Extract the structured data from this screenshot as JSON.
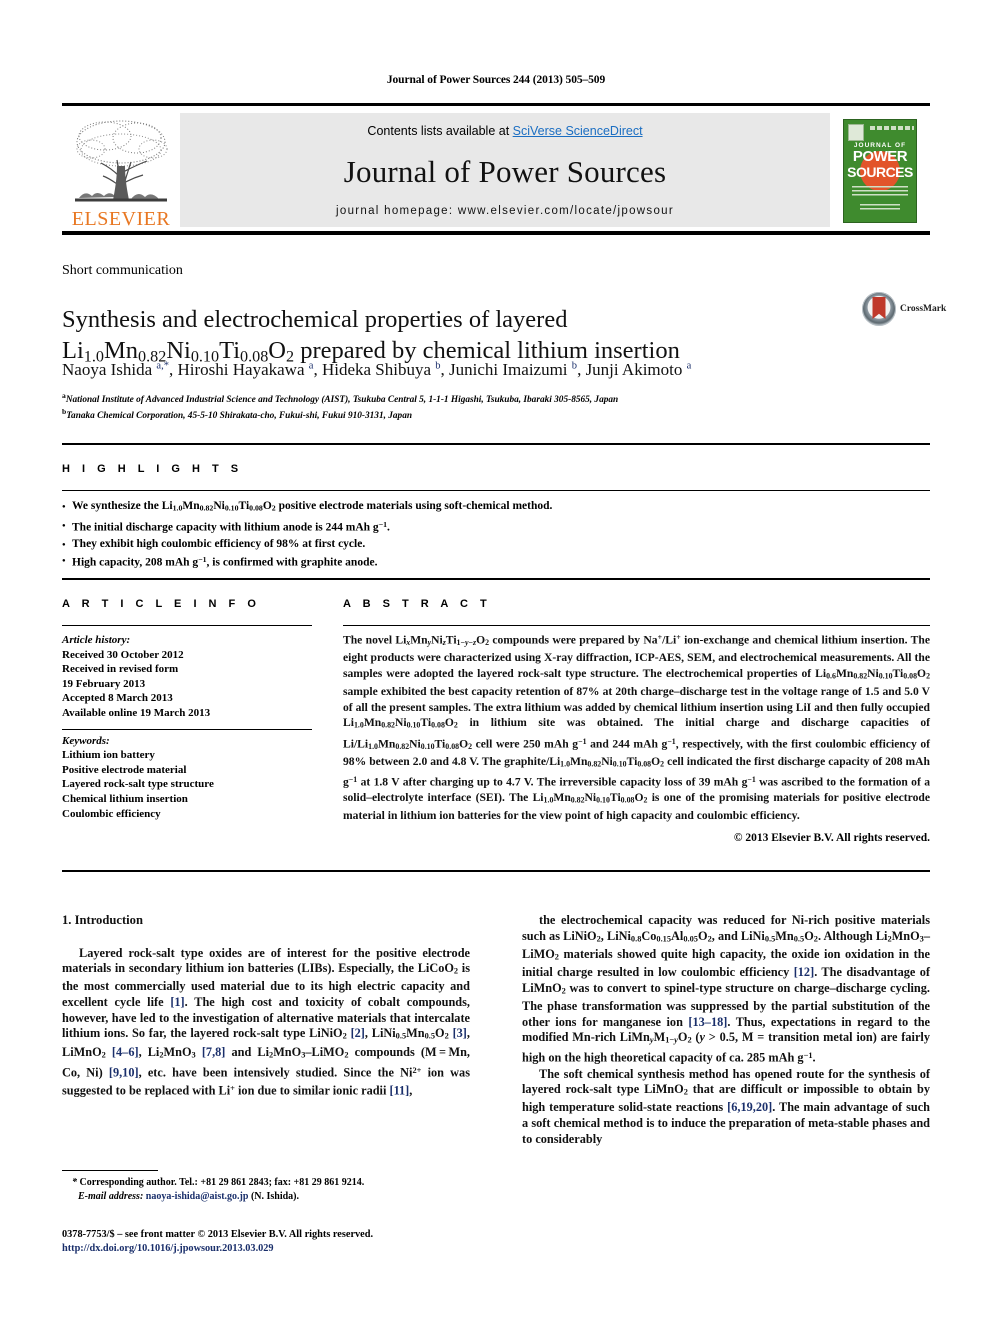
{
  "running_head": "Journal of Power Sources 244 (2013) 505–509",
  "masthead": {
    "publisher_name": "ELSEVIER",
    "contents_prefix": "Contents lists available at ",
    "contents_link": "SciVerse ScienceDirect",
    "journal_title": "Journal of Power Sources",
    "homepage_label": "journal homepage: www.elsevier.com/locate/jpowsour",
    "cover": {
      "line1": "JOURNAL OF",
      "line2": "POWER",
      "line3": "SOURCES"
    }
  },
  "article": {
    "type": "Short communication",
    "title_line1": "Synthesis and electrochemical properties of layered",
    "title_line2_html": "Li<sub>1.0</sub>Mn<sub>0.82</sub>Ni<sub>0.10</sub>Ti<sub>0.08</sub>O<sub>2</sub> prepared by chemical lithium insertion",
    "crossmark_label": "CrossMark",
    "authors_html": "Naoya Ishida <sup>a,*</sup>, Hiroshi Hayakawa <sup>a</sup>, Hideka Shibuya <sup>b</sup>, Junichi Imaizumi <sup>b</sup>, Junji Akimoto <sup>a</sup>",
    "affiliations": [
      "National Institute of Advanced Industrial Science and Technology (AIST), Tsukuba Central 5, 1-1-1 Higashi, Tsukuba, Ibaraki 305-8565, Japan",
      "Tanaka Chemical Corporation, 45-5-10 Shirakata-cho, Fukui-shi, Fukui 910-3131, Japan"
    ],
    "affiliation_marks": [
      "a",
      "b"
    ]
  },
  "highlights": {
    "heading": "H I G H L I G H T S",
    "items_html": [
      "We synthesize the Li<sub class=\"s\">1.0</sub>Mn<sub class=\"s\">0.82</sub>Ni<sub class=\"s\">0.10</sub>Ti<sub class=\"s\">0.08</sub>O<sub class=\"s\">2</sub> positive electrode materials using soft-chemical method.",
      "The initial discharge capacity with lithium anode is 244 mAh g<sup class=\"s\">−1</sup>.",
      "They exhibit high coulombic efficiency of 98% at first cycle.",
      "High capacity, 208 mAh g<sup class=\"s\">−1</sup>, is confirmed with graphite anode."
    ]
  },
  "article_info": {
    "heading": "A R T I C L E  I N F O",
    "history_label": "Article history:",
    "history_lines": [
      "Received 30 October 2012",
      "Received in revised form",
      "19 February 2013",
      "Accepted 8 March 2013",
      "Available online 19 March 2013"
    ],
    "keywords_label": "Keywords:",
    "keywords": [
      "Lithium ion battery",
      "Positive electrode material",
      "Layered rock-salt type structure",
      "Chemical lithium insertion",
      "Coulombic efficiency"
    ]
  },
  "abstract": {
    "heading": "A B S T R A C T",
    "body_html": "The novel Li<sub class=\"s\"><i>x</i></sub>Mn<sub class=\"s\"><i>y</i></sub>Ni<sub class=\"s\"><i>z</i></sub>Ti<sub class=\"s\">1−<i>y</i>−<i>z</i></sub>O<sub class=\"s\">2</sub> compounds were prepared by Na<sup class=\"s\">+</sup>/Li<sup class=\"s\">+</sup> ion-exchange and chemical lithium insertion. The eight products were characterized using X-ray diffraction, ICP-AES, SEM, and electrochemical measurements. All the samples were adopted the layered rock-salt type structure. The electrochemical properties of Li<sub class=\"s\">0.6</sub>Mn<sub class=\"s\">0.82</sub>Ni<sub class=\"s\">0.10</sub>Ti<sub class=\"s\">0.08</sub>O<sub class=\"s\">2</sub> sample exhibited the best capacity retention of 87% at 20th charge–discharge test in the voltage range of 1.5 and 5.0 V of all the present samples. The extra lithium was added by chemical lithium insertion using LiI and then fully occupied Li<sub class=\"s\">1.0</sub>Mn<sub class=\"s\">0.82</sub>Ni<sub class=\"s\">0.10</sub>Ti<sub class=\"s\">0.08</sub>O<sub class=\"s\">2</sub> in lithium site was obtained. The initial charge and discharge capacities of Li/Li<sub class=\"s\">1.0</sub>Mn<sub class=\"s\">0.82</sub>Ni<sub class=\"s\">0.10</sub>Ti<sub class=\"s\">0.08</sub>O<sub class=\"s\">2</sub> cell were 250 mAh g<sup class=\"s\">−1</sup> and 244 mAh g<sup class=\"s\">−1</sup>, respectively, with the first coulombic efficiency of 98% between 2.0 and 4.8 V. The graphite/Li<sub class=\"s\">1.0</sub>Mn<sub class=\"s\">0.82</sub>Ni<sub class=\"s\">0.10</sub>Ti<sub class=\"s\">0.08</sub>O<sub class=\"s\">2</sub> cell indicated the first discharge capacity of 208 mAh g<sup class=\"s\">−1</sup> at 1.8 V after charging up to 4.7 V. The irreversible capacity loss of 39 mAh g<sup class=\"s\">−1</sup> was ascribed to the formation of a solid–electrolyte interface (SEI). The Li<sub class=\"s\">1.0</sub>Mn<sub class=\"s\">0.82</sub>Ni<sub class=\"s\">0.10</sub>Ti<sub class=\"s\">0.08</sub>O<sub class=\"s\">2</sub> is one of the promising materials for positive electrode material in lithium ion batteries for the view point of high capacity and coulombic efficiency.",
    "copyright": "© 2013 Elsevier B.V. All rights reserved."
  },
  "introduction": {
    "section_number_title": "1.  Introduction",
    "left_paragraph_html": "Layered rock-salt type oxides are of interest for the positive electrode materials in secondary lithium ion batteries (LIBs). Especially, the LiCoO<sub class=\"s\">2</sub> is the most commercially used material due to its high electric capacity and excellent cycle life <span class=\"ref\">[1]</span>. The high cost and toxicity of cobalt compounds, however, have led to the investigation of alternative materials that intercalate lithium ions. So far, the layered rock-salt type LiNiO<sub class=\"s\">2</sub> <span class=\"ref\">[2]</span>, LiNi<sub class=\"s\">0.5</sub>Mn<sub class=\"s\">0.5</sub>O<sub class=\"s\">2</sub> <span class=\"ref\">[3]</span>, LiMnO<sub class=\"s\">2</sub> <span class=\"ref\">[4–6]</span>, Li<sub class=\"s\">2</sub>MnO<sub class=\"s\">3</sub> <span class=\"ref\">[7,8]</span> and Li<sub class=\"s\">2</sub>MnO<sub class=\"s\">3</sub>–LiMO<sub class=\"s\">2</sub> compounds (M = Mn, Co, Ni) <span class=\"ref\">[9,10]</span>, etc. have been intensively studied. Since the Ni<sup class=\"s\">2+</sup> ion was suggested to be replaced with Li<sup class=\"s\">+</sup> ion due to similar ionic radii <span class=\"ref\">[11]</span>,",
    "right_paragraph1_html": "the electrochemical capacity was reduced for Ni-rich positive materials such as LiNiO<sub class=\"s\">2</sub>, LiNi<sub class=\"s\">0.8</sub>Co<sub class=\"s\">0.15</sub>Al<sub class=\"s\">0.05</sub>O<sub class=\"s\">2</sub>, and LiNi<sub class=\"s\">0.5</sub>Mn<sub class=\"s\">0.5</sub>O<sub class=\"s\">2</sub>. Although Li<sub class=\"s\">2</sub>MnO<sub class=\"s\">3</sub>–LiMO<sub class=\"s\">2</sub> materials showed quite high capacity, the oxide ion oxidation in the initial charge resulted in low coulombic efficiency <span class=\"ref\">[12]</span>. The disadvantage of LiMnO<sub class=\"s\">2</sub> was to convert to spinel-type structure on charge–discharge cycling. The phase transformation was suppressed by the partial substitution of the other ions for manganese ion <span class=\"ref\">[13–18]</span>. Thus, expectations in regard to the modified Mn-rich LiMn<sub class=\"s\"><i>y</i></sub>M<sub class=\"s\">1−<i>y</i></sub>O<sub class=\"s\">2</sub> (<i>y</i> &gt; 0.5, M = transition metal ion) are fairly high on the high theoretical capacity of ca. 285 mAh g<sup class=\"s\">−1</sup>.",
    "right_paragraph2_html": "The soft chemical synthesis method has opened route for the synthesis of layered rock-salt type LiMnO<sub class=\"s\">2</sub> that are difficult or impossible to obtain by high temperature solid-state reactions <span class=\"ref\">[6,19,20]</span>. The main advantage of such a soft chemical method is to induce the preparation of meta-stable phases and to considerably"
  },
  "footer": {
    "corresponding_html": "<span class=\"it\">*</span> Corresponding author. Tel.: +81 29 861 2843; fax: +81 29 861 9214.",
    "email_html": "<span class=\"it\">E-mail address:</span> <span class=\"mailto\">naoya-ishida@aist.go.jp</span> (N. Ishida).",
    "issn_line": "0378-7753/$ – see front matter © 2013 Elsevier B.V. All rights reserved.",
    "doi_line": "http://dx.doi.org/10.1016/j.jpowsour.2013.03.029"
  },
  "colors": {
    "elsevier_orange": "#e87722",
    "link_blue": "#1b6ec2",
    "ref_blue": "#1a2f6b",
    "cover_green": "#3f8b2e",
    "crossmark_red": "#c0392b"
  }
}
